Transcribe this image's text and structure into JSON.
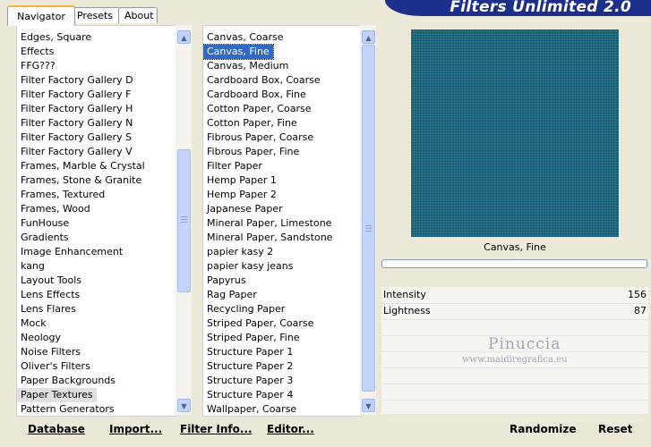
{
  "app": {
    "title": "Filters Unlimited 2.0"
  },
  "tabs": [
    {
      "label": "Navigator"
    },
    {
      "label": "Presets"
    },
    {
      "label": "About"
    }
  ],
  "categories": {
    "items": [
      "Edges, Square",
      "Effects",
      "FFG???",
      "Filter Factory Gallery D",
      "Filter Factory Gallery F",
      "Filter Factory Gallery H",
      "Filter Factory Gallery N",
      "Filter Factory Gallery S",
      "Filter Factory Gallery V",
      "Frames, Marble & Crystal",
      "Frames, Stone & Granite",
      "Frames, Textured",
      "Frames, Wood",
      "FunHouse",
      "Gradients",
      "Image Enhancement",
      "kang",
      "Layout Tools",
      "Lens Effects",
      "Lens Flares",
      "Mock",
      "Neology",
      "Noise Filters",
      "Oliver's Filters",
      "Paper Backgrounds",
      "Paper Textures",
      "Pattern Generators"
    ],
    "selected": "Paper Textures"
  },
  "filters": {
    "items": [
      "Canvas, Coarse",
      "Canvas, Fine",
      "Canvas, Medium",
      "Cardboard Box, Coarse",
      "Cardboard Box, Fine",
      "Cotton Paper, Coarse",
      "Cotton Paper, Fine",
      "Fibrous Paper, Coarse",
      "Fibrous Paper, Fine",
      "Filter Paper",
      "Hemp Paper 1",
      "Hemp Paper 2",
      "Japanese Paper",
      "Mineral Paper, Limestone",
      "Mineral Paper, Sandstone",
      "papier kasy 2",
      "papier kasy jeans",
      "Papyrus",
      "Rag Paper",
      "Recycling Paper",
      "Striped Paper, Coarse",
      "Striped Paper, Fine",
      "Structure Paper 1",
      "Structure Paper 2",
      "Structure Paper 3",
      "Structure Paper 4",
      "Wallpaper, Coarse"
    ],
    "selected": "Canvas, Fine"
  },
  "preview": {
    "texture_color": "#1e6b83",
    "filter_name": "Canvas, Fine"
  },
  "params": [
    {
      "label": "Intensity",
      "value": "156"
    },
    {
      "label": "Lightness",
      "value": "87"
    }
  ],
  "watermark": {
    "name": "Pinuccia",
    "url": "www.maidiregrafica.eu"
  },
  "buttons": {
    "database": "Database",
    "import": "Import...",
    "filter_info": "Filter Info...",
    "editor": "Editor...",
    "randomize": "Randomize",
    "reset": "Reset"
  },
  "colors": {
    "banner": "#1c2f8a",
    "window_bg": "#ece9d8",
    "selection_blue": "#316ac5",
    "scrollbar": "#c1d3fb"
  }
}
